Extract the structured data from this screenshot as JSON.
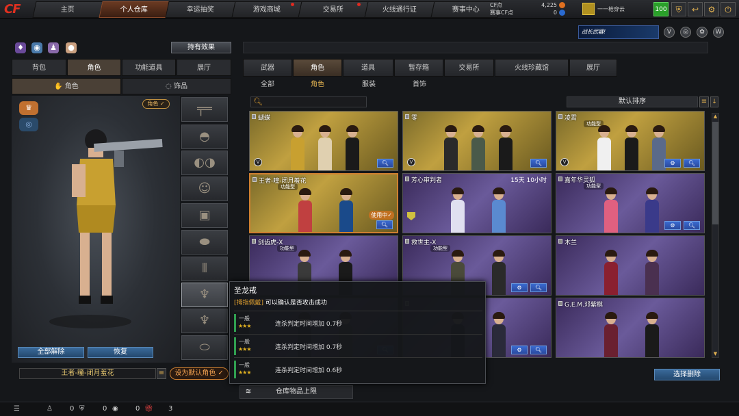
{
  "nav": {
    "logo": "CF",
    "tabs": [
      "主页",
      "个人仓库",
      "幸运抽奖",
      "游戏商城",
      "交易所",
      "火线通行证",
      "赛事中心"
    ],
    "active_tab": 1,
    "cf_label": "CF点",
    "cf_value": "4,225",
    "gift_cf_label": "赛事CF点",
    "gift_cf_value": "0",
    "player_name": "一一枪穿云",
    "level": "100"
  },
  "left": {
    "hold_effect": "持有效果",
    "tabs": [
      "背包",
      "角色",
      "功能道具",
      "展厅"
    ],
    "active_tab": 1,
    "subtabs": [
      "角色",
      "饰品"
    ],
    "role_tag": "角色 ✓",
    "unequip_all": "全部解除",
    "restore": "恢复",
    "current_name": "王者-瞳-闭月羞花",
    "set_default": "设为默认角色 ✓"
  },
  "right": {
    "promo": "战长武器!",
    "tabs": [
      "武器",
      "角色",
      "道具",
      "暂存箱",
      "交易所",
      "火线珍藏馆",
      "展厅"
    ],
    "active_tab": 1,
    "subtabs": [
      "全部",
      "角色",
      "服装",
      "首饰"
    ],
    "active_subtab": 1,
    "sort_label": "默认排序",
    "batch_delete": "选择删除",
    "capacity": "仓库物品上限"
  },
  "cards": [
    {
      "name": "蝴蝶",
      "style": "gold",
      "tag": "",
      "timer": "",
      "inuse": "",
      "v": true
    },
    {
      "name": "零",
      "style": "gold",
      "tag": "",
      "timer": "",
      "inuse": "",
      "v": true
    },
    {
      "name": "凌霄",
      "style": "gold",
      "tag": "功能型",
      "timer": "",
      "inuse": "",
      "v": true
    },
    {
      "name": "王者-瞳-闭月羞花",
      "style": "gold",
      "tag": "功能型",
      "timer": "",
      "inuse": "使用中✓",
      "v": false
    },
    {
      "name": "芳心审判者",
      "style": "purple",
      "tag": "",
      "timer": "15天 10小时",
      "inuse": "",
      "v": false
    },
    {
      "name": "嘉年华灵狐",
      "style": "purple",
      "tag": "功能型",
      "timer": "",
      "inuse": "",
      "v": false
    },
    {
      "name": "剑齿虎-X",
      "style": "purple",
      "tag": "功能型",
      "timer": "",
      "inuse": "",
      "v": false
    },
    {
      "name": "救世主-X",
      "style": "purple",
      "tag": "功能型",
      "timer": "",
      "inuse": "",
      "v": false
    },
    {
      "name": "木兰",
      "style": "purple",
      "tag": "",
      "timer": "",
      "inuse": "",
      "v": false
    },
    {
      "name": "",
      "style": "purple",
      "tag": "",
      "timer": "",
      "inuse": "",
      "v": false
    },
    {
      "name": "",
      "style": "purple",
      "tag": "",
      "timer": "",
      "inuse": "",
      "v": false
    },
    {
      "name": "G.E.M.邓紫棋",
      "style": "purple",
      "tag": "",
      "timer": "",
      "inuse": "",
      "v": false
    }
  ],
  "tooltip": {
    "title": "圣龙戒",
    "desc_tag": "[拇指佩戴]",
    "desc_text": " 可以确认是否攻击成功",
    "rows": [
      {
        "level": "一般",
        "stars": "★★★",
        "text": "连杀判定时间增加 0.7秒"
      },
      {
        "level": "一般",
        "stars": "★★★",
        "text": "连杀判定时间增加 0.7秒"
      },
      {
        "level": "一般",
        "stars": "★★★",
        "text": "连杀判定时间增加 0.6秒"
      }
    ]
  },
  "bottom": {
    "counts": [
      "0",
      "0",
      "0",
      "3"
    ]
  }
}
